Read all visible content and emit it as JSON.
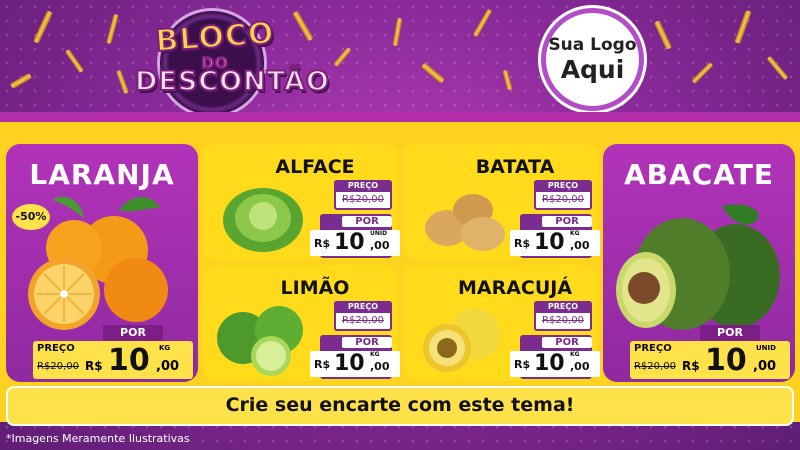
{
  "header": {
    "logo_line1": "BLOCO",
    "logo_line2": "DO",
    "logo_line3": "DESCONTÃO",
    "brand_line1": "Sua Logo",
    "brand_line2": "Aqui"
  },
  "products": {
    "laranja": {
      "name": "LARANJA",
      "badge": "-50%",
      "preco_label": "PREÇO",
      "old_price": "R$20,00",
      "por_label": "POR",
      "currency": "R$",
      "price_int": "10",
      "price_dec": ",00",
      "unit": "KG"
    },
    "alface": {
      "name": "ALFACE",
      "preco_label": "PREÇO",
      "old_price": "R$20,00",
      "por_label": "POR",
      "currency": "R$",
      "price_int": "10",
      "price_dec": ",00",
      "unit": "UNID"
    },
    "batata": {
      "name": "BATATA",
      "preco_label": "PREÇO",
      "old_price": "R$20,00",
      "por_label": "POR",
      "currency": "R$",
      "price_int": "10",
      "price_dec": ",00",
      "unit": "KG"
    },
    "limao": {
      "name": "LIMÃO",
      "preco_label": "PREÇO",
      "old_price": "R$20,00",
      "por_label": "POR",
      "currency": "R$",
      "price_int": "10",
      "price_dec": ",00",
      "unit": "KG"
    },
    "maracuja": {
      "name": "MARACUJÁ",
      "preco_label": "PREÇO",
      "old_price": "R$20,00",
      "por_label": "POR",
      "currency": "R$",
      "price_int": "10",
      "price_dec": ",00",
      "unit": "KG"
    },
    "abacate": {
      "name": "ABACATE",
      "preco_label": "PREÇO",
      "old_price": "R$20,00",
      "por_label": "POR",
      "currency": "R$",
      "price_int": "10",
      "price_dec": ",00",
      "unit": "UNID"
    }
  },
  "banner": {
    "text": "Crie seu encarte com este tema!"
  },
  "footer": {
    "note": "*Imagens Meramente Ilustrativas"
  },
  "colors": {
    "purple": "#8f2aa0",
    "yellow": "#ffdb1c",
    "tag_purple": "#7b2c8f"
  }
}
